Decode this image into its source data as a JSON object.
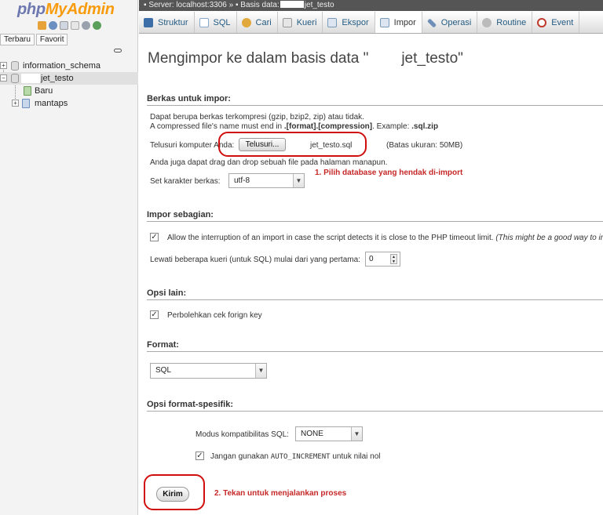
{
  "nav": {
    "logo_php": "php",
    "logo_rest": "MyAdmin",
    "tab_recent": "Terbaru",
    "tab_favorites": "Favorit",
    "tree": [
      {
        "label": "information_schema",
        "expander": "+"
      },
      {
        "label": "jet_testo",
        "expander": "−"
      },
      {
        "label": "Baru"
      },
      {
        "label": "mantaps",
        "expander": "+"
      }
    ]
  },
  "breadcrumb": {
    "server": "Server: localhost:3306",
    "sep": "»",
    "db_prefix": "Basis data:",
    "db_suffix": "jet_testo"
  },
  "tabs": [
    {
      "label": "Struktur",
      "icon": "structure-icon",
      "color": "#3d6ea8"
    },
    {
      "label": "SQL",
      "icon": "sql-icon",
      "color": "#8aa8c8"
    },
    {
      "label": "Cari",
      "icon": "search-icon",
      "color": "#e1a93b"
    },
    {
      "label": "Kueri",
      "icon": "query-icon",
      "color": "#a0a0a0"
    },
    {
      "label": "Ekspor",
      "icon": "export-icon",
      "color": "#7a9ab9"
    },
    {
      "label": "Impor",
      "icon": "import-icon",
      "color": "#7a9ab9",
      "active": true
    },
    {
      "label": "Operasi",
      "icon": "wrench-icon",
      "color": "#6e8fb8"
    },
    {
      "label": "Routine",
      "icon": "routine-icon",
      "color": "#999999"
    },
    {
      "label": "Event",
      "icon": "clock-icon",
      "color": "#c0392b"
    }
  ],
  "main": {
    "title_prefix": "Mengimpor ke dalam basis data \"",
    "title_db": "jet_testo\"",
    "section_file": "Berkas untuk impor:",
    "file_hint1": "Dapat berupa berkas terkompresi (gzip, bzip2, zip) atau tidak.",
    "file_hint2_a": "A compressed file's name must end in ",
    "file_hint2_b": ".[format].[compression]",
    "file_hint2_c": ". Example: ",
    "file_hint2_d": ".sql.zip",
    "browse_label_a": "Telusuri komputer A",
    "browse_label_b": "nda:",
    "browse_button": "Telusuri...",
    "file_name": "jet_testo.sql",
    "max_size": "(Batas ukuran: 50MB)",
    "drag_hint": "Anda juga dapat drag dan drop sebuah file pada halaman manapun.",
    "charset_label": "Set karakter berkas:",
    "charset_value": "utf-8",
    "section_partial": "Impor sebagian:",
    "allow_interrupt_a": "Allow the interruption of an import in case the script detects it is close to the PHP timeout limit.",
    "allow_interrupt_b": " (This might be a good way to im",
    "skip_label": "Lewati beberapa kueri (untuk SQL) mulai dari yang pertama:",
    "skip_value": "0",
    "section_other": "Opsi lain:",
    "fk_label": "Perbolehkan cek forign key",
    "section_format": "Format:",
    "format_value": "SQL",
    "section_format_specific": "Opsi format-spesifik:",
    "compat_label": "Modus kompatibilitas SQL:",
    "compat_value": "NONE",
    "autoinc_a": "Jangan gunakan ",
    "autoinc_b": "AUTO_INCREMENT",
    "autoinc_c": " untuk nilai nol",
    "submit": "Kirim",
    "check_mark": "✓"
  },
  "annotations": {
    "step1": "1. Pilih database yang hendak di-import",
    "step2": "2. Tekan untuk menjalankan proses"
  },
  "colors": {
    "annotation_red": "#c62828",
    "box_red": "#d10e0e",
    "logo_blue": "#6c78af",
    "logo_orange": "#f89c0e",
    "link": "#235a81"
  }
}
